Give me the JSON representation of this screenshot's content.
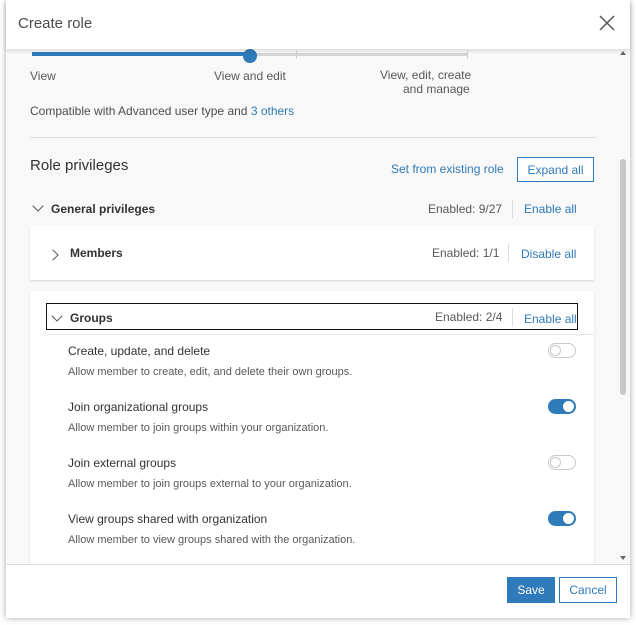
{
  "dialog": {
    "title": "Create role",
    "close_icon": "close-icon"
  },
  "access_slider": {
    "levels": [
      "View",
      "View and edit",
      "View, edit, create",
      "and manage"
    ],
    "selected": "View and edit",
    "accent": "#2f7ab8"
  },
  "compat": {
    "text": "Compatible with Advanced user type and",
    "link": "3 others"
  },
  "privileges": {
    "title": "Role privileges",
    "set_from_existing": "Set from existing role",
    "expand_all": "Expand all",
    "general": {
      "label": "General privileges",
      "enabled": "Enabled: 9/27",
      "action": "Enable all"
    },
    "members": {
      "label": "Members",
      "enabled": "Enabled: 1/1",
      "action": "Disable all"
    },
    "groups": {
      "label": "Groups",
      "enabled": "Enabled: 2/4",
      "action": "Enable all",
      "items": [
        {
          "title": "Create, update, and delete",
          "desc": "Allow member to create, edit, and delete their own groups.",
          "enabled": false
        },
        {
          "title": "Join organizational groups",
          "desc": "Allow member to join groups within your organization.",
          "enabled": true
        },
        {
          "title": "Join external groups",
          "desc": "Allow member to join groups external to your organization.",
          "enabled": false
        },
        {
          "title": "View groups shared with organization",
          "desc": "Allow member to view groups shared with the organization.",
          "enabled": true
        }
      ]
    }
  },
  "footer": {
    "save": "Save",
    "cancel": "Cancel"
  }
}
